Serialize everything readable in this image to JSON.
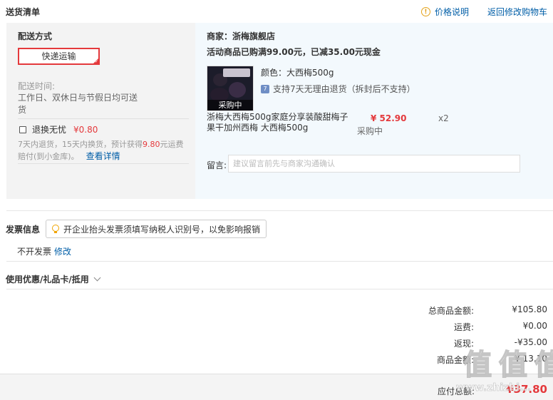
{
  "header": {
    "title": "送货清单",
    "price_note": "价格说明",
    "back_cart": "返回修改购物车",
    "info_icon": "info-icon"
  },
  "shipping": {
    "mode_label": "配送方式",
    "mode_value": "快递运输",
    "time_label": "配送时间:",
    "time_value": "工作日、双休日与节假日均可送货",
    "swap_label": "退换无忧",
    "swap_price": "¥0.80",
    "swap_desc_pre": "7天内退货，15天内换货，预计获得",
    "swap_desc_amt": "9.80",
    "swap_desc_post": "元运费赔付(到小金库)。",
    "swap_detail": "查看详情"
  },
  "order": {
    "shop": "商家：浙梅旗舰店",
    "promo": "活动商品已购满99.00元，已减35.00元现金",
    "thumb_badge": "采购中",
    "attr": "颜色：大西梅500g",
    "return_icon": "7",
    "return_text": "支持7天无理由退货（拆封后不支持）",
    "product_name": "浙梅大西梅500g家庭分享装酸甜梅子果干加州西梅 大西梅500g",
    "price": "¥ 52.90",
    "stock": "采购中",
    "qty": "x2",
    "memo_label": "留言:",
    "memo_placeholder": "建议留言前先与商家沟通确认"
  },
  "invoice": {
    "title": "发票信息",
    "tip": "开企业抬头发票须填写纳税人识别号，以免影响报销",
    "value": "不开发票",
    "edit": "修改"
  },
  "coupon": {
    "label": "使用优惠/礼品卡/抵用"
  },
  "summary": {
    "rows": [
      {
        "label": "总商品金额:",
        "value": "¥105.80"
      },
      {
        "label": "运费:",
        "value": "¥0.00"
      },
      {
        "label": "返现:",
        "value": "-¥35.00"
      },
      {
        "label": "商品金额:",
        "value": "¥ 13.10"
      }
    ],
    "pay_label": "应付总额:",
    "pay_value": "¥37.80"
  },
  "watermark": {
    "text": "值 值 值",
    "url": "www.zhizhi..."
  },
  "colors": {
    "accent": "#e4393c",
    "link": "#005ea7",
    "right_panel": "#f3f9fd",
    "left_panel": "#f3f3f3"
  }
}
